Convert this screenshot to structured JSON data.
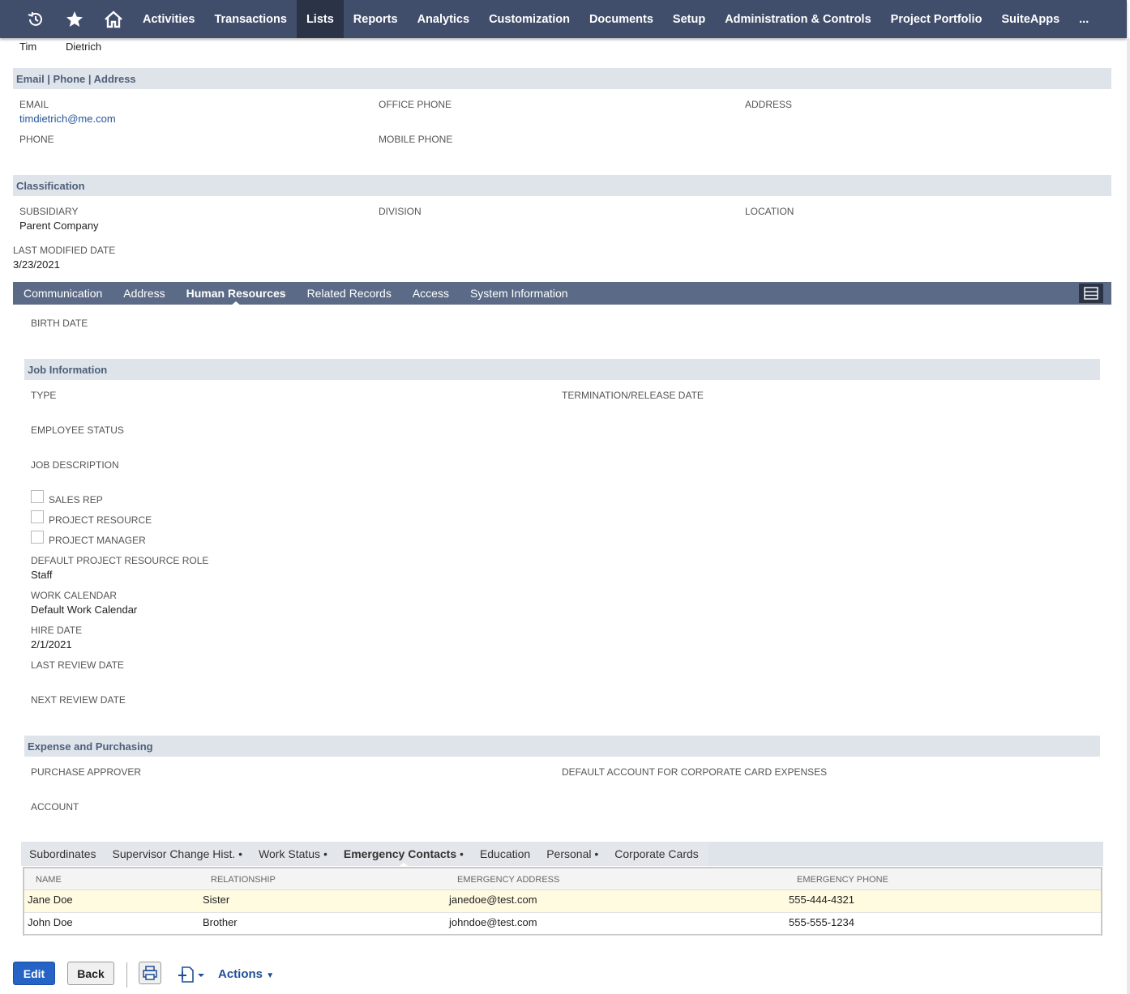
{
  "nav": {
    "items": [
      "Activities",
      "Transactions",
      "Lists",
      "Reports",
      "Analytics",
      "Customization",
      "Documents",
      "Setup",
      "Administration & Controls",
      "Project Portfolio",
      "SuiteApps",
      "..."
    ],
    "active": "Lists",
    "icons": [
      "recent-icon",
      "star-icon",
      "home-icon"
    ]
  },
  "name": {
    "first": "Tim",
    "last": "Dietrich"
  },
  "contact": {
    "header": "Email | Phone | Address",
    "email_label": "EMAIL",
    "email_value": "timdietrich@me.com",
    "office_phone_label": "OFFICE PHONE",
    "address_label": "ADDRESS",
    "phone_label": "PHONE",
    "mobile_phone_label": "MOBILE PHONE"
  },
  "classification": {
    "header": "Classification",
    "subsidiary_label": "SUBSIDIARY",
    "subsidiary_value": "Parent Company",
    "division_label": "DIVISION",
    "location_label": "LOCATION"
  },
  "last_modified": {
    "label": "LAST MODIFIED DATE",
    "value": "3/23/2021"
  },
  "tabs": [
    {
      "label": "Communication"
    },
    {
      "label": "Address"
    },
    {
      "label": "Human Resources"
    },
    {
      "label": "Related Records"
    },
    {
      "label": "Access"
    },
    {
      "label": "System Information"
    }
  ],
  "active_tab": "Human Resources",
  "hr": {
    "birth_date_label": "BIRTH DATE",
    "job_info_header": "Job Information",
    "type_label": "TYPE",
    "termination_label": "TERMINATION/RELEASE DATE",
    "employee_status_label": "EMPLOYEE STATUS",
    "job_description_label": "JOB DESCRIPTION",
    "sales_rep_label": "SALES REP",
    "project_resource_label": "PROJECT RESOURCE",
    "project_manager_label": "PROJECT MANAGER",
    "default_role_label": "DEFAULT PROJECT RESOURCE ROLE",
    "default_role_value": "Staff",
    "work_calendar_label": "WORK CALENDAR",
    "work_calendar_value": "Default Work Calendar",
    "hire_date_label": "HIRE DATE",
    "hire_date_value": "2/1/2021",
    "last_review_label": "LAST REVIEW DATE",
    "next_review_label": "NEXT REVIEW DATE",
    "expense_header": "Expense and Purchasing",
    "purchase_approver_label": "PURCHASE APPROVER",
    "default_account_label": "DEFAULT ACCOUNT FOR CORPORATE CARD EXPENSES",
    "account_label": "ACCOUNT"
  },
  "subtabs": [
    {
      "label": "Subordinates",
      "dot": ""
    },
    {
      "label": "Supervisor Change Hist.",
      "dot": " •"
    },
    {
      "label": "Work Status",
      "dot": " •"
    },
    {
      "label": "Emergency Contacts",
      "dot": " •"
    },
    {
      "label": "Education",
      "dot": ""
    },
    {
      "label": "Personal",
      "dot": " •"
    },
    {
      "label": "Corporate Cards",
      "dot": ""
    }
  ],
  "active_subtab": "Emergency Contacts",
  "contacts_table": {
    "headers": [
      "NAME",
      "RELATIONSHIP",
      "EMERGENCY ADDRESS",
      "EMERGENCY PHONE"
    ],
    "rows": [
      [
        "Jane Doe",
        "Sister",
        "janedoe@test.com",
        "555-444-4321"
      ],
      [
        "John Doe",
        "Brother",
        "johndoe@test.com",
        "555-555-1234"
      ]
    ]
  },
  "footer": {
    "edit_label": "Edit",
    "back_label": "Back",
    "actions_label": "Actions"
  }
}
